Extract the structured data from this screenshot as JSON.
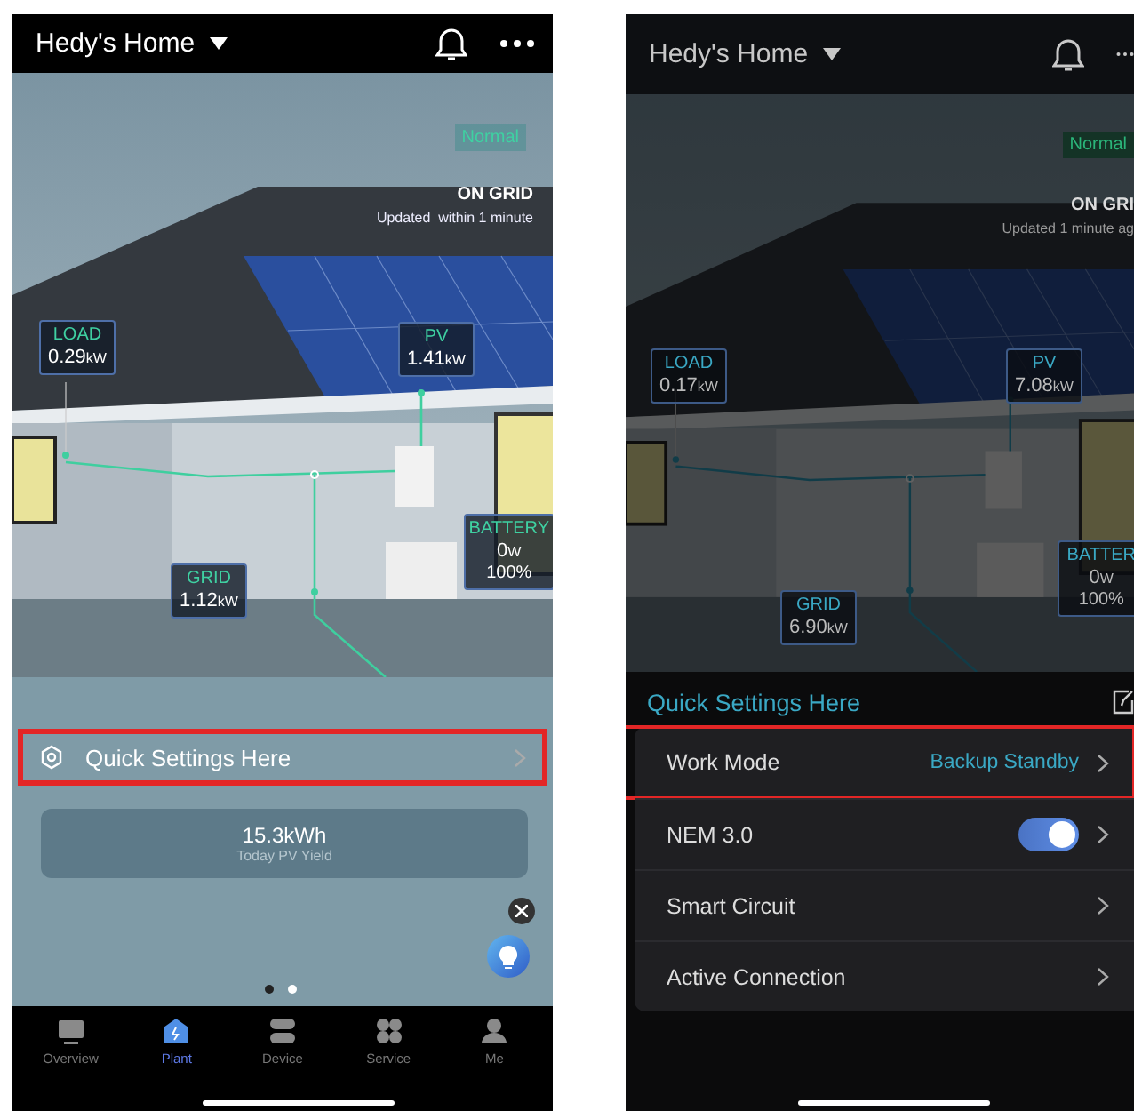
{
  "phones": [
    {
      "kind": "light",
      "header": {
        "title": "Hedy's Home"
      },
      "scene": {
        "status": "Normal",
        "grid_state": "ON GRID",
        "updated": "Updated  within 1 minute",
        "nodes": [
          {
            "kind": "load",
            "label": "LOAD",
            "value": "0.29",
            "unit": "kW"
          },
          {
            "kind": "pv",
            "label": "PV",
            "value": "1.41",
            "unit": "kW"
          },
          {
            "kind": "battery",
            "label": "BATTERY",
            "value": "0",
            "unit": "W",
            "extra": "100%"
          },
          {
            "kind": "grid",
            "label": "GRID",
            "value": "1.12",
            "unit": "kW"
          }
        ]
      },
      "quick_settings": {
        "label": "Quick Settings Here",
        "highlighted": true
      },
      "yield": {
        "value": "15.3kWh",
        "label": "Today PV Yield"
      },
      "page_dots": [
        {
          "selected": false
        },
        {
          "selected": true
        }
      ],
      "tabs": [
        {
          "kind": "overview",
          "label": "Overview",
          "selected": false
        },
        {
          "kind": "plant",
          "label": "Plant",
          "selected": true
        },
        {
          "kind": "device",
          "label": "Device",
          "selected": false
        },
        {
          "kind": "service",
          "label": "Service",
          "selected": false
        },
        {
          "kind": "me",
          "label": "Me",
          "selected": false
        }
      ]
    },
    {
      "kind": "dark",
      "header": {
        "title": "Hedy's Home"
      },
      "scene": {
        "status": "Normal",
        "grid_state": "ON GRI",
        "updated": "Updated 1 minute ag",
        "nodes": [
          {
            "kind": "load",
            "label": "LOAD",
            "value": "0.17",
            "unit": "kW"
          },
          {
            "kind": "pv",
            "label": "PV",
            "value": "7.08",
            "unit": "kW"
          },
          {
            "kind": "battery",
            "label": "BATTER",
            "value": "0",
            "unit": "W",
            "extra": "100%"
          },
          {
            "kind": "grid",
            "label": "GRID",
            "value": "6.90",
            "unit": "kW"
          }
        ]
      },
      "settings_title": "Quick Settings Here",
      "settings": [
        {
          "kind": "value",
          "label": "Work Mode",
          "value": "Backup Standby",
          "highlighted": true
        },
        {
          "kind": "toggle",
          "label": "NEM 3.0",
          "on": true,
          "highlighted": false
        },
        {
          "kind": "link",
          "label": "Smart Circuit",
          "highlighted": false
        },
        {
          "kind": "link",
          "label": "Active Connection",
          "highlighted": false
        }
      ]
    }
  ]
}
